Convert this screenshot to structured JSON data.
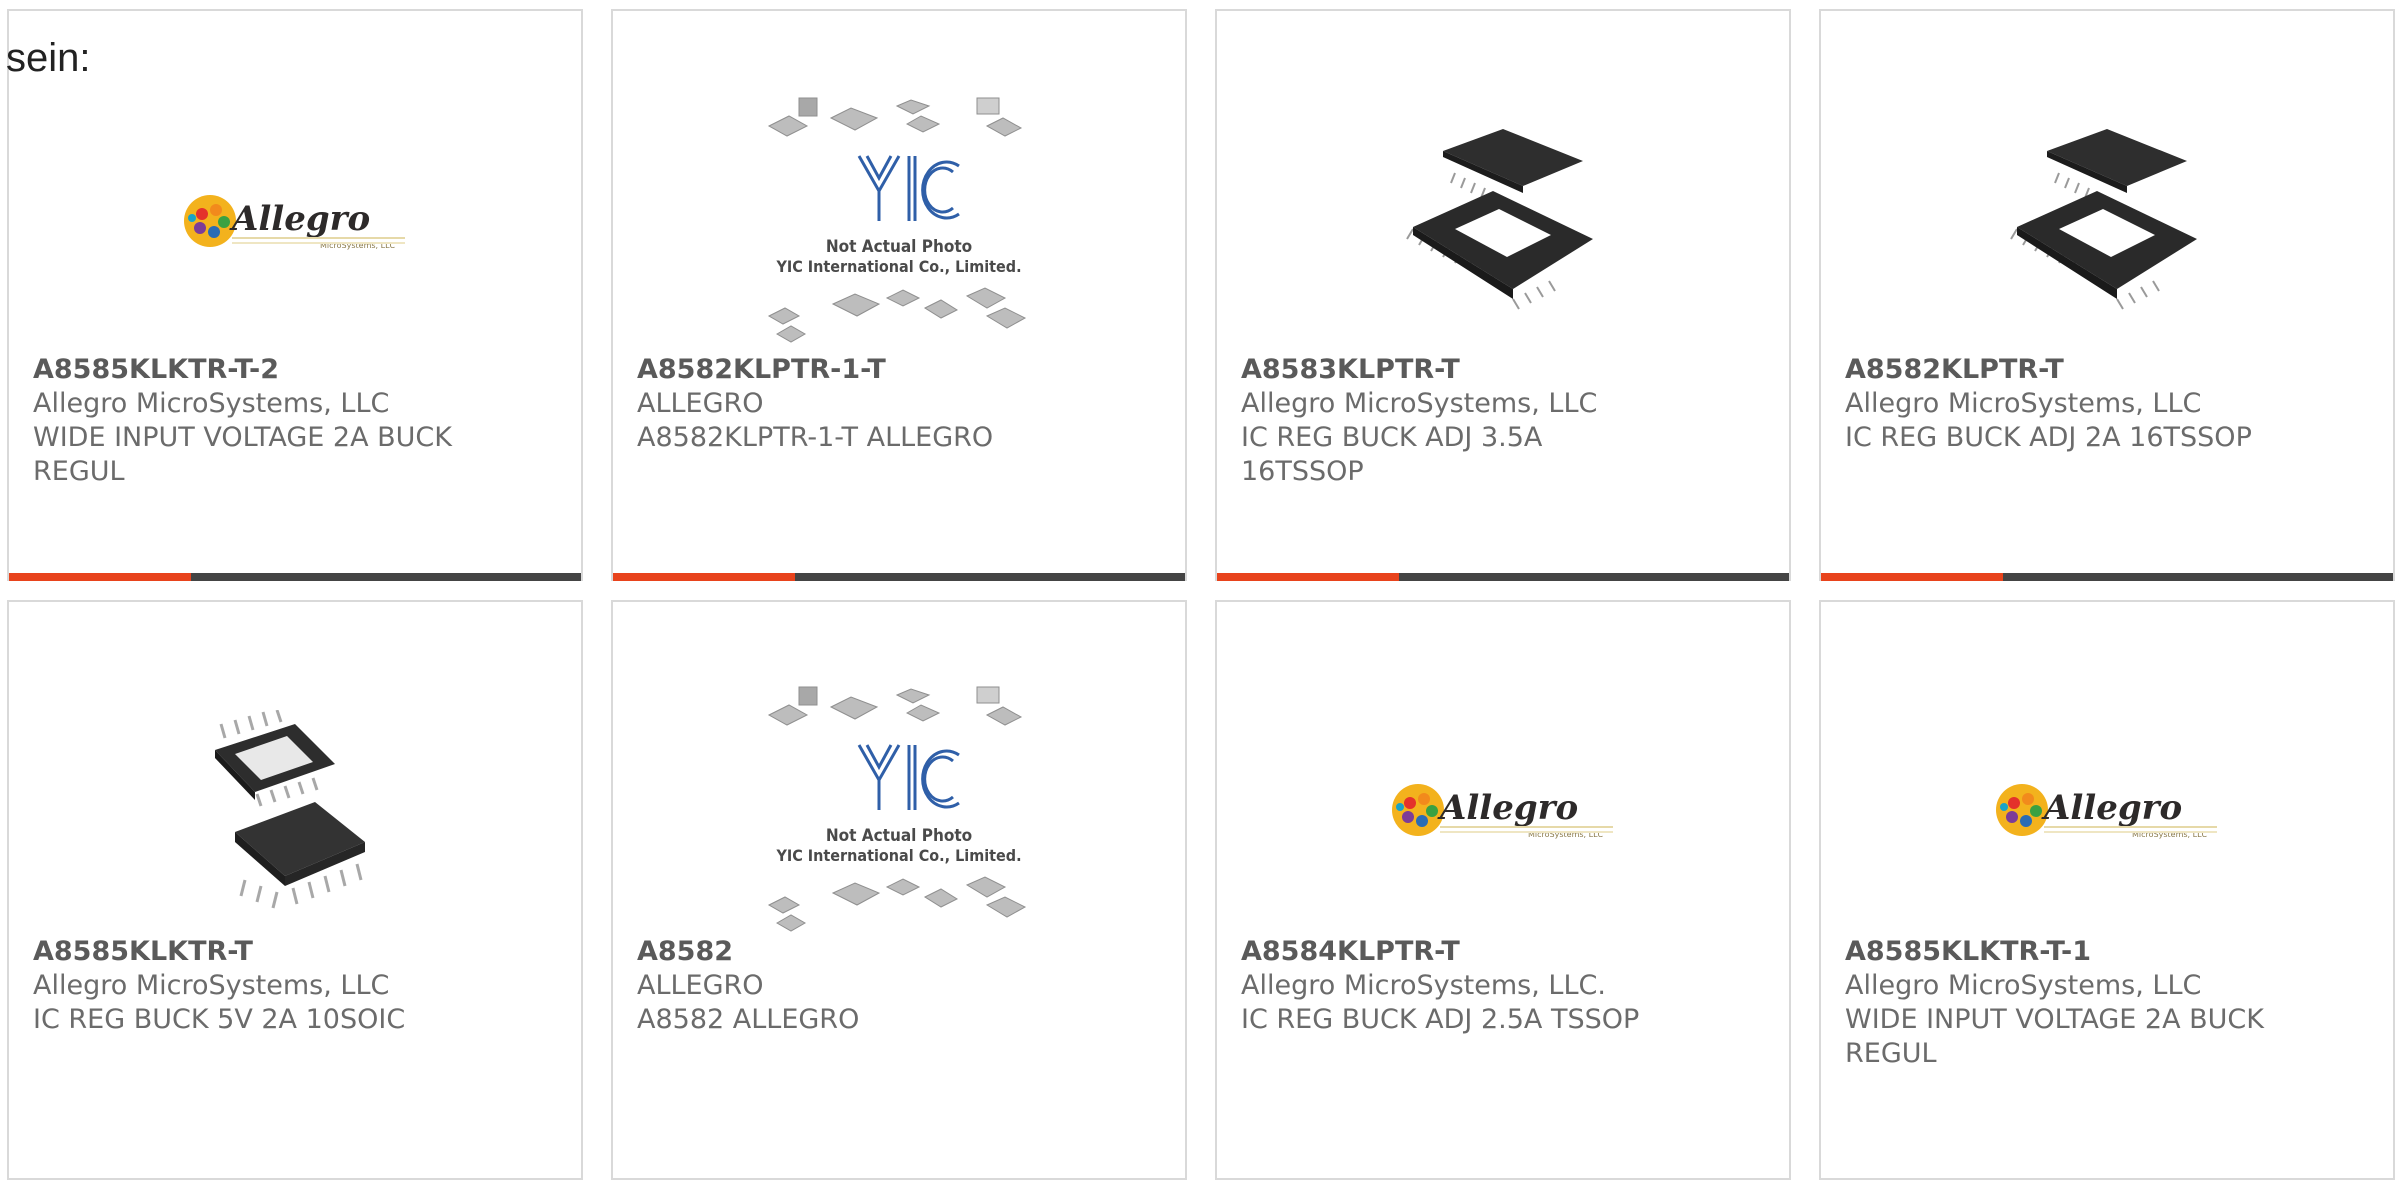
{
  "heading": "sein:",
  "colors": {
    "accent": "#e8431c",
    "bar": "#444444",
    "border": "#d9d9d9"
  },
  "placeholder": {
    "line1": "Not Actual Photo",
    "line2": "YIC International Co., Limited.",
    "logo": "YIC"
  },
  "logo_text": {
    "brand": "Allegro",
    "sub": "MicroSystems, LLC"
  },
  "products": [
    {
      "part": "A8585KLKTR-T-2",
      "maker": "Allegro MicroSystems, LLC",
      "desc": "WIDE INPUT VOLTAGE 2A BUCK REGUL",
      "image": "allegro-logo"
    },
    {
      "part": "A8582KLPTR-1-T",
      "maker": "ALLEGRO",
      "desc": "A8582KLPTR-1-T ALLEGRO",
      "image": "yic-placeholder"
    },
    {
      "part": "A8583KLPTR-T",
      "maker": "Allegro MicroSystems, LLC",
      "desc": "IC REG BUCK ADJ 3.5A 16TSSOP",
      "image": "tssop-package"
    },
    {
      "part": "A8582KLPTR-T",
      "maker": "Allegro MicroSystems, LLC",
      "desc": "IC REG BUCK ADJ 2A 16TSSOP",
      "image": "tssop-package"
    },
    {
      "part": "A8585KLKTR-T",
      "maker": "Allegro MicroSystems, LLC",
      "desc": "IC REG BUCK 5V 2A 10SOIC",
      "image": "soic-package"
    },
    {
      "part": "A8582",
      "maker": "ALLEGRO",
      "desc": "A8582 ALLEGRO",
      "image": "yic-placeholder"
    },
    {
      "part": "A8584KLPTR-T",
      "maker": "Allegro MicroSystems, LLC.",
      "desc": "IC REG BUCK ADJ 2.5A TSSOP",
      "image": "allegro-logo"
    },
    {
      "part": "A8585KLKTR-T-1",
      "maker": "Allegro MicroSystems, LLC",
      "desc": "WIDE INPUT VOLTAGE 2A BUCK REGUL",
      "image": "allegro-logo"
    }
  ]
}
